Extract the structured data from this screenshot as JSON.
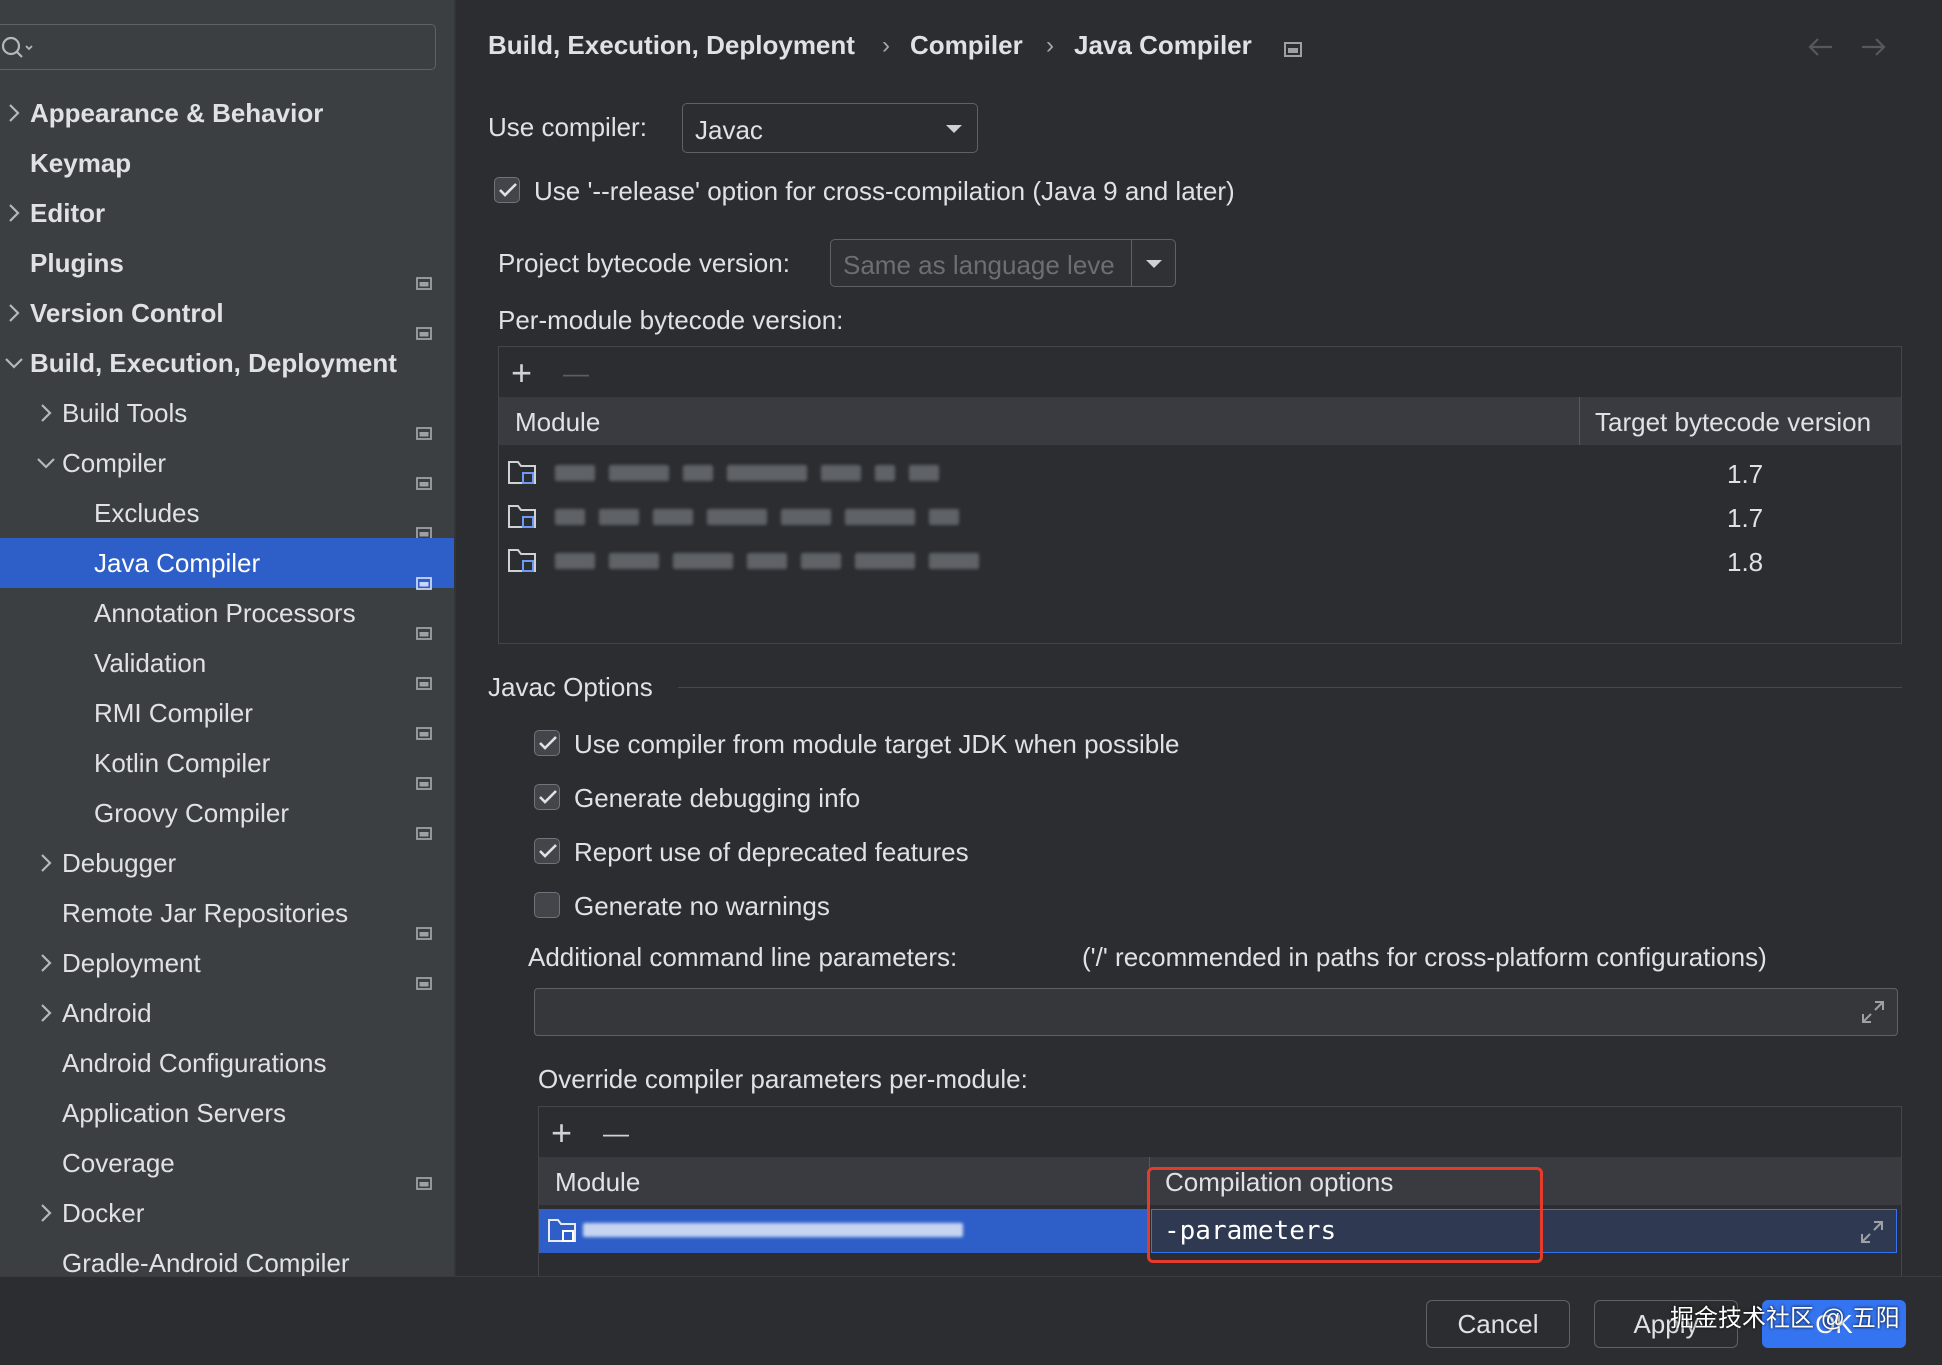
{
  "sidebar": {
    "search_placeholder": "",
    "items": [
      {
        "label": "Appearance & Behavior",
        "level": 0,
        "chevron": "right",
        "bold": true,
        "badge": false
      },
      {
        "label": "Keymap",
        "level": 0,
        "chevron": "",
        "bold": true,
        "badge": false
      },
      {
        "label": "Editor",
        "level": 0,
        "chevron": "right",
        "bold": true,
        "badge": false
      },
      {
        "label": "Plugins",
        "level": 0,
        "chevron": "",
        "bold": true,
        "badge": true
      },
      {
        "label": "Version Control",
        "level": 0,
        "chevron": "right",
        "bold": true,
        "badge": true
      },
      {
        "label": "Build, Execution, Deployment",
        "level": 0,
        "chevron": "down",
        "bold": true,
        "badge": false
      },
      {
        "label": "Build Tools",
        "level": 1,
        "chevron": "right",
        "bold": false,
        "badge": true
      },
      {
        "label": "Compiler",
        "level": 1,
        "chevron": "down",
        "bold": false,
        "badge": true
      },
      {
        "label": "Excludes",
        "level": 2,
        "chevron": "",
        "bold": false,
        "badge": true
      },
      {
        "label": "Java Compiler",
        "level": 2,
        "chevron": "",
        "bold": false,
        "badge": true,
        "selected": true
      },
      {
        "label": "Annotation Processors",
        "level": 2,
        "chevron": "",
        "bold": false,
        "badge": true
      },
      {
        "label": "Validation",
        "level": 2,
        "chevron": "",
        "bold": false,
        "badge": true
      },
      {
        "label": "RMI Compiler",
        "level": 2,
        "chevron": "",
        "bold": false,
        "badge": true
      },
      {
        "label": "Kotlin Compiler",
        "level": 2,
        "chevron": "",
        "bold": false,
        "badge": true
      },
      {
        "label": "Groovy Compiler",
        "level": 2,
        "chevron": "",
        "bold": false,
        "badge": true
      },
      {
        "label": "Debugger",
        "level": 1,
        "chevron": "right",
        "bold": false,
        "badge": false
      },
      {
        "label": "Remote Jar Repositories",
        "level": 1,
        "chevron": "",
        "bold": false,
        "badge": true
      },
      {
        "label": "Deployment",
        "level": 1,
        "chevron": "right",
        "bold": false,
        "badge": true
      },
      {
        "label": "Android",
        "level": 1,
        "chevron": "right",
        "bold": false,
        "badge": false
      },
      {
        "label": "Android Configurations",
        "level": 1,
        "chevron": "",
        "bold": false,
        "badge": false
      },
      {
        "label": "Application Servers",
        "level": 1,
        "chevron": "",
        "bold": false,
        "badge": false
      },
      {
        "label": "Coverage",
        "level": 1,
        "chevron": "",
        "bold": false,
        "badge": true
      },
      {
        "label": "Docker",
        "level": 1,
        "chevron": "right",
        "bold": false,
        "badge": false
      },
      {
        "label": "Gradle-Android Compiler",
        "level": 1,
        "chevron": "",
        "bold": false,
        "badge": true
      }
    ]
  },
  "breadcrumb": {
    "items": [
      "Build, Execution, Deployment",
      "Compiler",
      "Java Compiler"
    ],
    "separator": "›"
  },
  "compiler": {
    "use_compiler_label": "Use compiler:",
    "use_compiler_value": "Javac",
    "release_option_label": "Use '--release' option for cross-compilation (Java 9 and later)",
    "release_option_checked": true,
    "project_bytecode_label": "Project bytecode version:",
    "project_bytecode_placeholder": "Same as language leve",
    "per_module_label": "Per-module bytecode version:"
  },
  "bytecode_table": {
    "add": "+",
    "remove": "—",
    "columns": [
      "Module",
      "Target bytecode version"
    ],
    "rows": [
      {
        "module": "",
        "version": "1.7"
      },
      {
        "module": "",
        "version": "1.7"
      },
      {
        "module": "",
        "version": "1.8"
      }
    ]
  },
  "javac_options": {
    "section_title": "Javac Options",
    "options": [
      {
        "label": "Use compiler from module target JDK when possible",
        "checked": true
      },
      {
        "label": "Generate debugging info",
        "checked": true
      },
      {
        "label": "Report use of deprecated features",
        "checked": true
      },
      {
        "label": "Generate no warnings",
        "checked": false
      }
    ],
    "additional_params_label": "Additional command line parameters:",
    "additional_params_hint": "('/' recommended in paths for cross-platform configurations)",
    "additional_params_value": "",
    "override_label": "Override compiler parameters per-module:"
  },
  "override_table": {
    "add": "+",
    "remove": "—",
    "columns": [
      "Module",
      "Compilation options"
    ],
    "rows": [
      {
        "module": "",
        "options": "-parameters"
      }
    ]
  },
  "footer": {
    "help": "?",
    "cancel": "Cancel",
    "apply": "Apply",
    "ok": "OK",
    "watermark": "掘金技术社区 @ 五阳"
  },
  "colors": {
    "selection": "#2e5fc8",
    "primary_button": "#3574f0",
    "highlight_box": "#e53b2c"
  }
}
